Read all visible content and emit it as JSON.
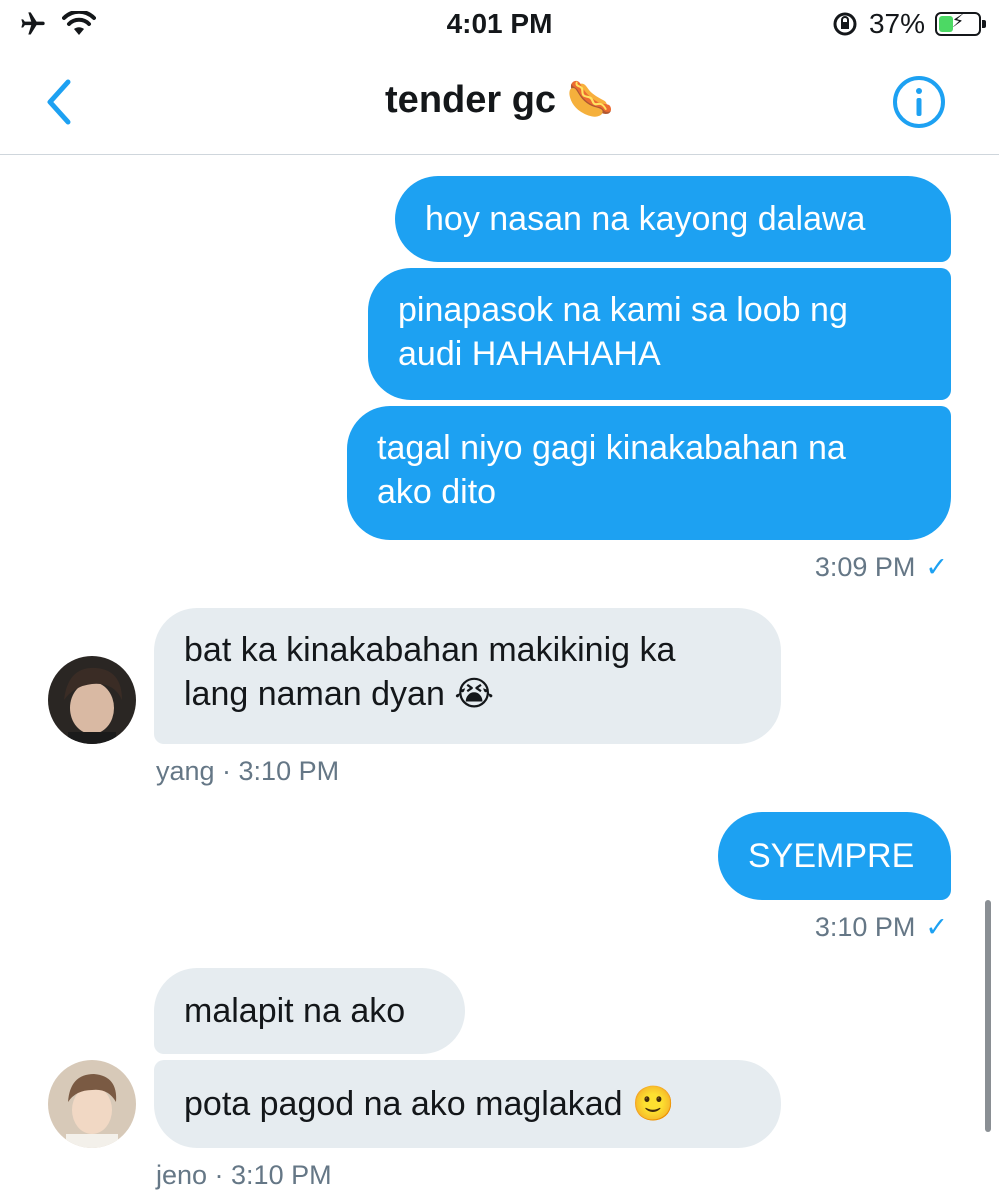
{
  "status_bar": {
    "time": "4:01 PM",
    "battery_percent": "37%",
    "battery_level": 0.37,
    "icons": [
      "airplane-icon",
      "wifi-icon",
      "rotation-lock-icon",
      "battery-charging-icon"
    ]
  },
  "nav": {
    "title": "tender gc 🌭",
    "back_icon": "chevron-left-icon",
    "info_icon": "info-icon"
  },
  "colors": {
    "accent": "#1da1f2",
    "incoming_bubble": "#e6ecf0",
    "meta_text": "#657786"
  },
  "messages": {
    "m1": "hoy nasan na kayong dalawa",
    "m2_line1": "pinapasok na kami sa loob ng",
    "m2_line2": "audi HAHAHAHA",
    "m3_line1": "tagal niyo gagi kinakabahan na",
    "m3_line2": "ako dito",
    "t1": "3:09 PM",
    "m4_line1": "bat ka kinakabahan makikinig ka",
    "m4_line2": "lang naman dyan 😭",
    "yang_meta": "yang · 3:10 PM",
    "m5": "SYEMPRE",
    "t2": "3:10 PM",
    "m6": "malapit na ako",
    "m7": "pota pagod na ako maglakad 🙂",
    "jeno_meta": "jeno · 3:10 PM",
    "check": "✓"
  }
}
